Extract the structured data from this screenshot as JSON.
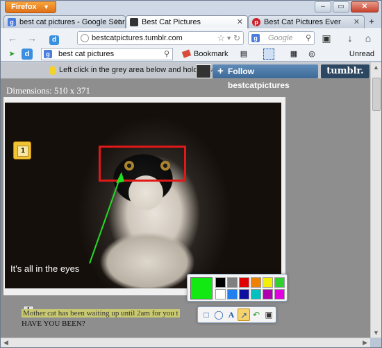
{
  "browser": {
    "app_button": "Firefox",
    "window_controls": [
      "–",
      "▭",
      "✕"
    ]
  },
  "tabs": [
    {
      "label": "best cat pictures - Google Search",
      "favicon": "google-icon",
      "active": false
    },
    {
      "label": "Best Cat Pictures",
      "favicon": "cat-favicon",
      "active": true
    },
    {
      "label": "Best Cat Pictures Ever",
      "favicon": "pinterest-icon",
      "active": false
    }
  ],
  "navbar": {
    "url": "bestcatpictures.tumblr.com",
    "search_placeholder": "Google"
  },
  "toolbar2": {
    "search_value": "best cat pictures",
    "bookmark_label": "Bookmark",
    "unread_label": "Unread"
  },
  "page": {
    "notice": "Left click in the grey area below and hold to select",
    "follow_label": "Follow bestcatpictures",
    "tumblr_logo": "tumblr.",
    "dimensions": "Dimensions: 510 x 371",
    "caption": "It's all in the eyes",
    "note_number": "1",
    "text_number": "1",
    "text_line1": "Mother cat has been waiting up until 2am for you t",
    "text_line2": "HAVE YOU BEEN?"
  },
  "annotation": {
    "current_color": "#12e812",
    "palette": [
      "#000000",
      "#808080",
      "#e00000",
      "#f08000",
      "#f0f000",
      "#30d030",
      "#ffffff",
      "#2080f0",
      "#1010a0",
      "#00c0c0",
      "#b000b0",
      "#e000e0"
    ],
    "tools": [
      "rectangle-tool",
      "ellipse-tool",
      "text-tool",
      "arrow-tool",
      "undo-tool",
      "save-tool"
    ],
    "selected_tool": "arrow-tool"
  }
}
